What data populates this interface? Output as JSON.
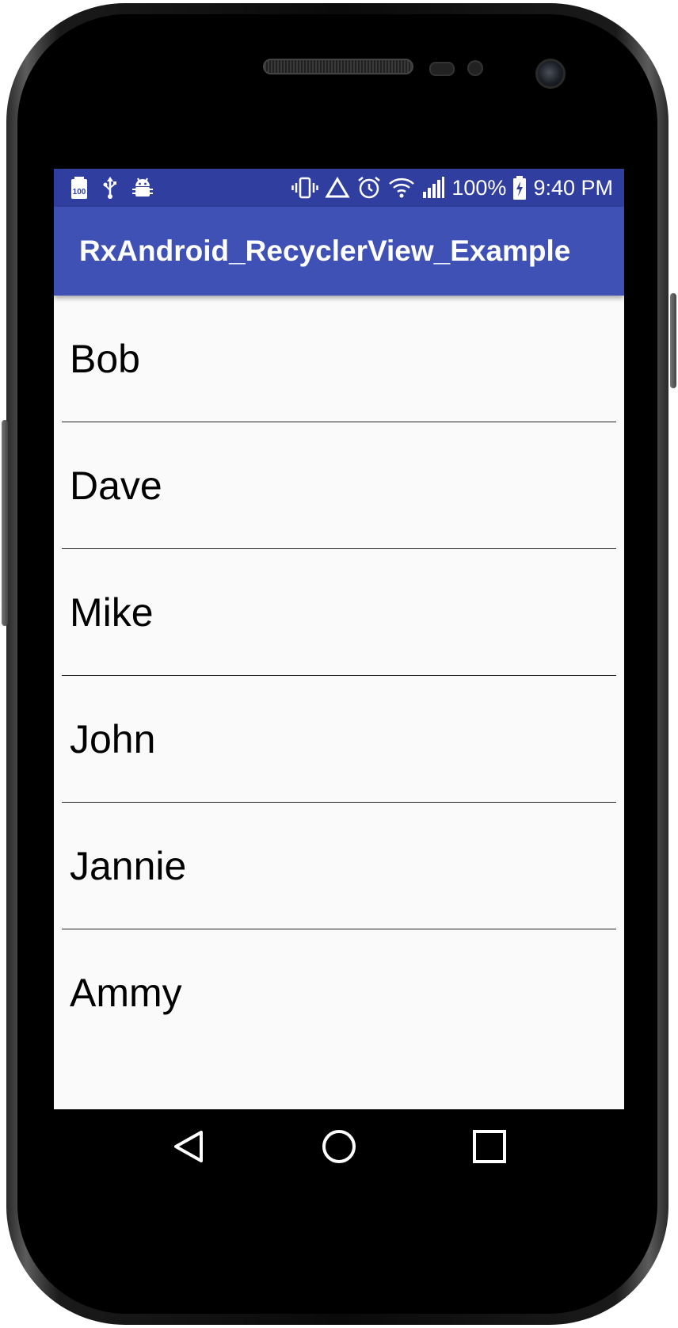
{
  "status_bar": {
    "battery_percent": "100%",
    "time": "9:40 PM",
    "left_icons": [
      "battery-100-icon",
      "usb-icon",
      "android-debug-icon"
    ],
    "right_icons": [
      "vibrate-icon",
      "warning-triangle-icon",
      "alarm-icon",
      "wifi-icon",
      "signal-icon",
      "battery-charging-icon"
    ]
  },
  "toolbar": {
    "title": "RxAndroid_RecyclerView_Example"
  },
  "list": {
    "items": [
      {
        "label": "Bob"
      },
      {
        "label": "Dave"
      },
      {
        "label": "Mike"
      },
      {
        "label": "John"
      },
      {
        "label": "Jannie"
      },
      {
        "label": "Ammy"
      }
    ]
  },
  "nav_bar": {
    "icons": [
      "back-icon",
      "home-icon",
      "recents-icon"
    ]
  },
  "colors": {
    "status_bar": "#303f9f",
    "toolbar": "#3f51b5",
    "list_background": "#fafafa"
  }
}
